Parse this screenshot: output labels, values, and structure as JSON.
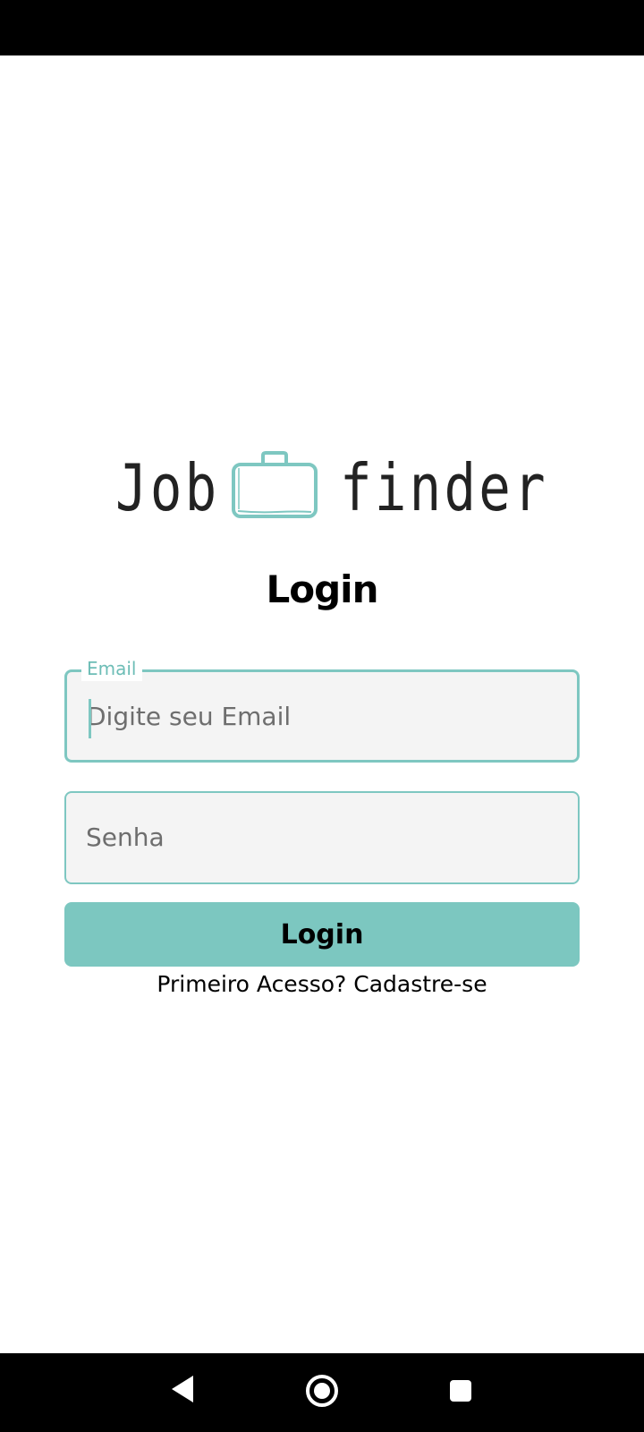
{
  "app": {
    "logo_left": "Job",
    "logo_right": "finder",
    "accent_color": "#7ec7c1"
  },
  "login": {
    "title": "Login",
    "email": {
      "label": "Email",
      "placeholder": "Digite seu Email",
      "value": ""
    },
    "password": {
      "placeholder": "Senha",
      "value": ""
    },
    "submit_label": "Login",
    "signup_link": "Primeiro Acesso? Cadastre-se"
  },
  "system_nav": {
    "icons": [
      "back-icon",
      "home-icon",
      "recents-icon"
    ]
  }
}
